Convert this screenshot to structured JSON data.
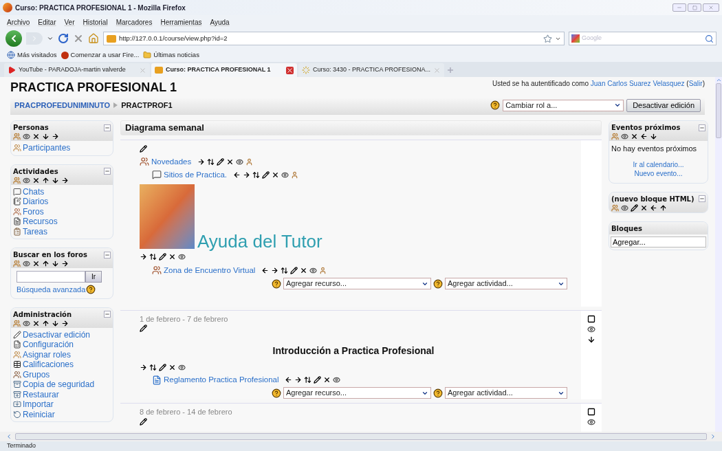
{
  "window": {
    "title": "Curso: PRACTICA PROFESIONAL 1 - Mozilla Firefox"
  },
  "menu": [
    "Archivo",
    "Editar",
    "Ver",
    "Historial",
    "Marcadores",
    "Herramientas",
    "Ayuda"
  ],
  "address": {
    "url": "http://127.0.0.1/course/view.php?id=2"
  },
  "search": {
    "placeholder": "Google"
  },
  "bookmarks": [
    {
      "label": "Más visitados",
      "kind": "globe"
    },
    {
      "label": "Comenzar a usar Fire...",
      "kind": "logo"
    },
    {
      "label": "Últimas noticias",
      "kind": "folder"
    }
  ],
  "tabs": [
    {
      "label": "YouTube - PARADOJA-martin valverde",
      "selected": false,
      "kind": "video"
    },
    {
      "label": "Curso: PRACTICA PROFESIONAL 1",
      "selected": true,
      "kind": "logo"
    },
    {
      "label": "Curso: 3430 - PRACTICA PROFESIONA...",
      "selected": false,
      "kind": "loading"
    }
  ],
  "page": {
    "title": "PRACTICA PROFESIONAL 1",
    "login": [
      {
        "kind": "text",
        "text": "Usted se ha autentificado como "
      },
      {
        "kind": "link",
        "text": "Juan Carlos Suarez Velasquez"
      },
      {
        "kind": "text",
        "text": " ("
      },
      {
        "kind": "link",
        "text": "Salir"
      },
      {
        "kind": "text",
        "text": ")"
      }
    ],
    "breadcrumb": [
      "PRACPROFEDUNIMINUTO",
      "PRACTPROF1"
    ],
    "role_select": "Cambiar rol a...",
    "edit_button": "Desactivar edición"
  },
  "left_blocks": [
    {
      "kind": "list",
      "title": "Personas",
      "controls": [
        {
          "kind": "roles"
        },
        {
          "kind": "hide"
        },
        {
          "kind": "delete"
        },
        {
          "kind": "down"
        },
        {
          "kind": "right"
        }
      ],
      "items": [
        {
          "label": "Participantes",
          "kind": "people"
        }
      ]
    },
    {
      "kind": "list",
      "title": "Actividades",
      "controls": [
        {
          "kind": "roles"
        },
        {
          "kind": "hide"
        },
        {
          "kind": "delete"
        },
        {
          "kind": "up"
        },
        {
          "kind": "down"
        },
        {
          "kind": "right"
        }
      ],
      "items": [
        {
          "label": "Chats",
          "kind": "chat"
        },
        {
          "label": "Diarios",
          "kind": "journal"
        },
        {
          "label": "Foros",
          "kind": "forum"
        },
        {
          "label": "Recursos",
          "kind": "resource"
        },
        {
          "label": "Tareas",
          "kind": "assignment"
        }
      ]
    },
    {
      "kind": "search",
      "title": "Buscar en los foros",
      "controls": [
        {
          "kind": "roles"
        },
        {
          "kind": "hide"
        },
        {
          "kind": "delete"
        },
        {
          "kind": "up"
        },
        {
          "kind": "down"
        },
        {
          "kind": "right"
        }
      ],
      "button": "Ir",
      "link": "Búsqueda avanzada"
    },
    {
      "kind": "list",
      "title": "Administración",
      "controls": [
        {
          "kind": "roles"
        },
        {
          "kind": "hide"
        },
        {
          "kind": "delete"
        },
        {
          "kind": "up"
        },
        {
          "kind": "down"
        },
        {
          "kind": "right"
        }
      ],
      "items": [
        {
          "label": "Desactivar edición",
          "kind": "edit"
        },
        {
          "label": "Configuración",
          "kind": "settings"
        },
        {
          "label": "Asignar roles",
          "kind": "people"
        },
        {
          "label": "Calificaciones",
          "kind": "grades"
        },
        {
          "label": "Grupos",
          "kind": "groups"
        },
        {
          "label": "Copia de seguridad",
          "kind": "backup"
        },
        {
          "label": "Restaurar",
          "kind": "restore"
        },
        {
          "label": "Importar",
          "kind": "import"
        },
        {
          "label": "Reiniciar",
          "kind": "reset"
        }
      ]
    }
  ],
  "center": {
    "header": "Diagrama semanal",
    "sections": [
      {
        "items": [
          {
            "kind": "edit"
          },
          {
            "kind": "forum",
            "label": "Novedades",
            "controls": [
              {
                "kind": "right"
              },
              {
                "kind": "updown"
              },
              {
                "kind": "edit"
              },
              {
                "kind": "delete"
              },
              {
                "kind": "hide"
              },
              {
                "kind": "person"
              }
            ],
            "children": [
              {
                "kind": "chat",
                "label": "Sitios de Practica.",
                "controls": [
                  {
                    "kind": "left"
                  },
                  {
                    "kind": "right"
                  },
                  {
                    "kind": "updown"
                  },
                  {
                    "kind": "edit"
                  },
                  {
                    "kind": "delete"
                  },
                  {
                    "kind": "hide"
                  },
                  {
                    "kind": "person"
                  }
                ]
              }
            ]
          },
          {
            "kind": "label",
            "text": "Ayuda del Tutor"
          },
          {
            "kind": "controls",
            "controls": [
              {
                "kind": "right"
              },
              {
                "kind": "updown"
              },
              {
                "kind": "edit"
              },
              {
                "kind": "delete"
              },
              {
                "kind": "hide"
              }
            ],
            "children": [
              {
                "kind": "forum",
                "label": "Zona de Encuentro Virtual",
                "controls": [
                  {
                    "kind": "left"
                  },
                  {
                    "kind": "right"
                  },
                  {
                    "kind": "updown"
                  },
                  {
                    "kind": "edit"
                  },
                  {
                    "kind": "delete"
                  },
                  {
                    "kind": "hide"
                  },
                  {
                    "kind": "person"
                  }
                ]
              }
            ]
          },
          {
            "kind": "add",
            "resource": "Agregar recurso...",
            "activity": "Agregar actividad..."
          }
        ]
      },
      {
        "date": "1 de febrero - 7 de febrero",
        "side_controls": [
          {
            "kind": "square"
          },
          {
            "kind": "hide"
          },
          {
            "kind": "down"
          }
        ],
        "items": [
          {
            "kind": "edit"
          },
          {
            "kind": "heading",
            "text": "Introducción a Practica Profesional"
          },
          {
            "kind": "controls",
            "controls": [
              {
                "kind": "right"
              },
              {
                "kind": "updown"
              },
              {
                "kind": "edit"
              },
              {
                "kind": "delete"
              },
              {
                "kind": "hide"
              }
            ],
            "children": [
              {
                "kind": "document",
                "label": "Reglamento Practica Profesional",
                "controls": [
                  {
                    "kind": "left"
                  },
                  {
                    "kind": "right"
                  },
                  {
                    "kind": "updown"
                  },
                  {
                    "kind": "edit"
                  },
                  {
                    "kind": "delete"
                  },
                  {
                    "kind": "hide"
                  }
                ]
              }
            ]
          },
          {
            "kind": "add",
            "resource": "Agregar recurso...",
            "activity": "Agregar actividad..."
          }
        ]
      },
      {
        "date": "8 de febrero - 14 de febrero",
        "side_controls": [
          {
            "kind": "square"
          },
          {
            "kind": "hide"
          }
        ],
        "items": [
          {
            "kind": "edit"
          }
        ]
      }
    ]
  },
  "right_blocks": [
    {
      "kind": "events",
      "title": "Eventos próximos",
      "controls": [
        {
          "kind": "roles"
        },
        {
          "kind": "hide"
        },
        {
          "kind": "delete"
        },
        {
          "kind": "left"
        },
        {
          "kind": "down"
        }
      ],
      "text": "No hay eventos próximos",
      "links": [
        "Ir al calendario...",
        "Nuevo evento..."
      ]
    },
    {
      "kind": "empty",
      "title": "(nuevo bloque HTML)",
      "controls": [
        {
          "kind": "roles"
        },
        {
          "kind": "hide"
        },
        {
          "kind": "edit"
        },
        {
          "kind": "delete"
        },
        {
          "kind": "left"
        },
        {
          "kind": "up"
        }
      ]
    },
    {
      "kind": "select",
      "title": "Bloques",
      "select": "Agregar..."
    }
  ],
  "status_bar": {
    "text": "Terminado"
  }
}
